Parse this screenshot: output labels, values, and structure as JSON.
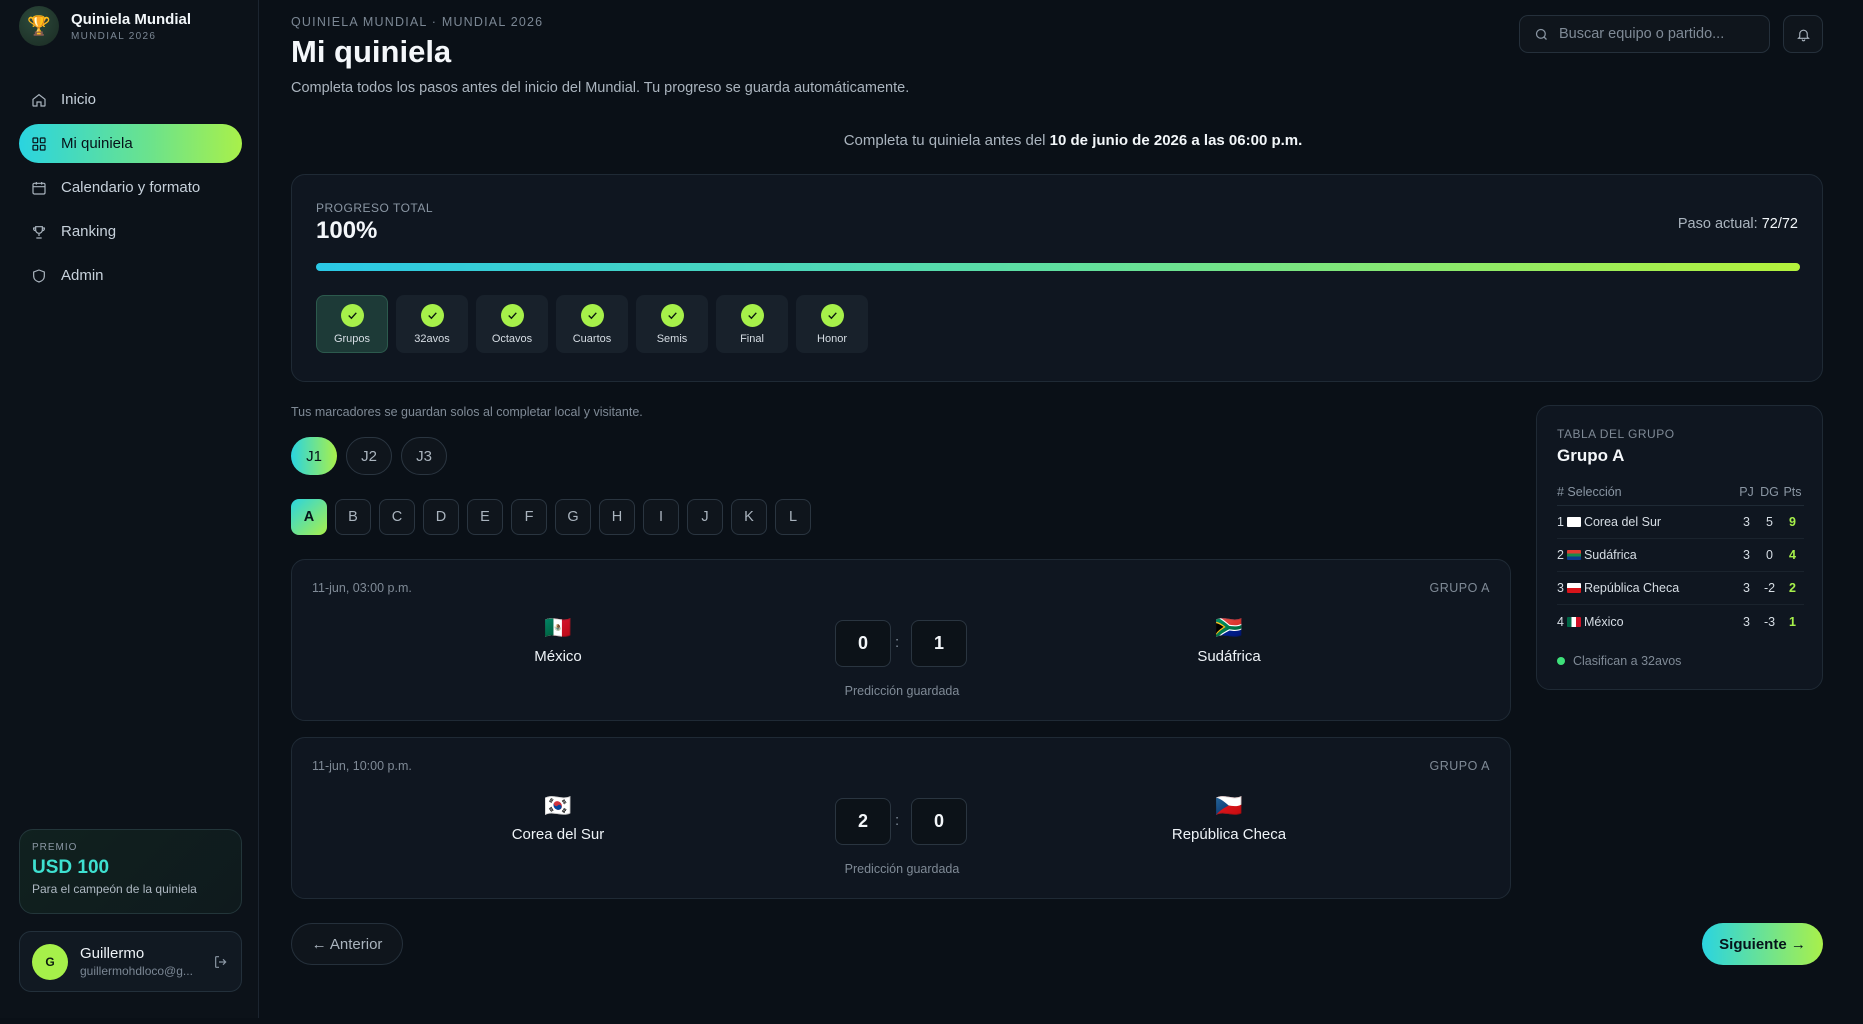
{
  "brand": {
    "title": "Quiniela Mundial",
    "subtitle": "MUNDIAL 2026",
    "icon": "trophy-icon"
  },
  "nav": [
    {
      "label": "Inicio",
      "icon": "home-icon"
    },
    {
      "label": "Mi quiniela",
      "icon": "grid-icon",
      "active": true
    },
    {
      "label": "Calendario y formato",
      "icon": "calendar-icon"
    },
    {
      "label": "Ranking",
      "icon": "trophy-icon"
    },
    {
      "label": "Admin",
      "icon": "shield-icon"
    }
  ],
  "prize": {
    "label": "PREMIO",
    "amount": "USD 100",
    "description": "Para el campeón de la quiniela"
  },
  "user": {
    "initial": "G",
    "name": "Guillermo",
    "email": "guillermohdloco@g..."
  },
  "header": {
    "breadcrumb": "QUINIELA MUNDIAL · MUNDIAL 2026",
    "title": "Mi quiniela",
    "subtitle": "Completa todos los pasos antes del inicio del Mundial. Tu progreso se guarda automáticamente.",
    "search_placeholder": "Buscar equipo o partido..."
  },
  "deadline": {
    "prefix": "Completa tu quiniela antes del ",
    "date": "10 de junio de 2026 a las 06:00 p.m."
  },
  "progress": {
    "label": "PROGRESO TOTAL",
    "value_text": "100%",
    "value": 1.0,
    "step_prefix": "Paso actual: ",
    "step_value": "72/72",
    "steps": [
      "Grupos",
      "32avos",
      "Octavos",
      "Cuartos",
      "Semis",
      "Final",
      "Honor"
    ]
  },
  "autosave_note": "Tus marcadores se guardan solos al completar local y visitante.",
  "rounds": [
    "J1",
    "J2",
    "J3"
  ],
  "groups": [
    "A",
    "B",
    "C",
    "D",
    "E",
    "F",
    "G",
    "H",
    "I",
    "J",
    "K",
    "L"
  ],
  "matches": [
    {
      "date": "11-jun, 03:00 p.m.",
      "group": "GRUPO A",
      "home": "México",
      "home_flag": "🇲🇽",
      "away": "Sudáfrica",
      "away_flag": "🇿🇦",
      "home_score": "0",
      "away_score": "1",
      "status": "Predicción guardada"
    },
    {
      "date": "11-jun, 10:00 p.m.",
      "group": "GRUPO A",
      "home": "Corea del Sur",
      "home_flag": "🇰🇷",
      "away": "República Checa",
      "away_flag": "🇨🇿",
      "home_score": "2",
      "away_score": "0",
      "status": "Predicción guardada"
    }
  ],
  "group_table": {
    "label": "TABLA DEL GRUPO",
    "title": "Grupo A",
    "headers": {
      "team": "# Selección",
      "pj": "PJ",
      "dg": "DG",
      "pts": "Pts"
    },
    "rows": [
      {
        "pos": "1",
        "team": "Corea del Sur",
        "pj": "3",
        "dg": "5",
        "pts": "9"
      },
      {
        "pos": "2",
        "team": "Sudáfrica",
        "pj": "3",
        "dg": "0",
        "pts": "4"
      },
      {
        "pos": "3",
        "team": "República Checa",
        "pj": "3",
        "dg": "-2",
        "pts": "2"
      },
      {
        "pos": "4",
        "team": "México",
        "pj": "3",
        "dg": "-3",
        "pts": "1"
      }
    ],
    "legend": "Clasifican a 32avos"
  },
  "footer": {
    "prev": "← Anterior",
    "next": "Siguiente →"
  }
}
